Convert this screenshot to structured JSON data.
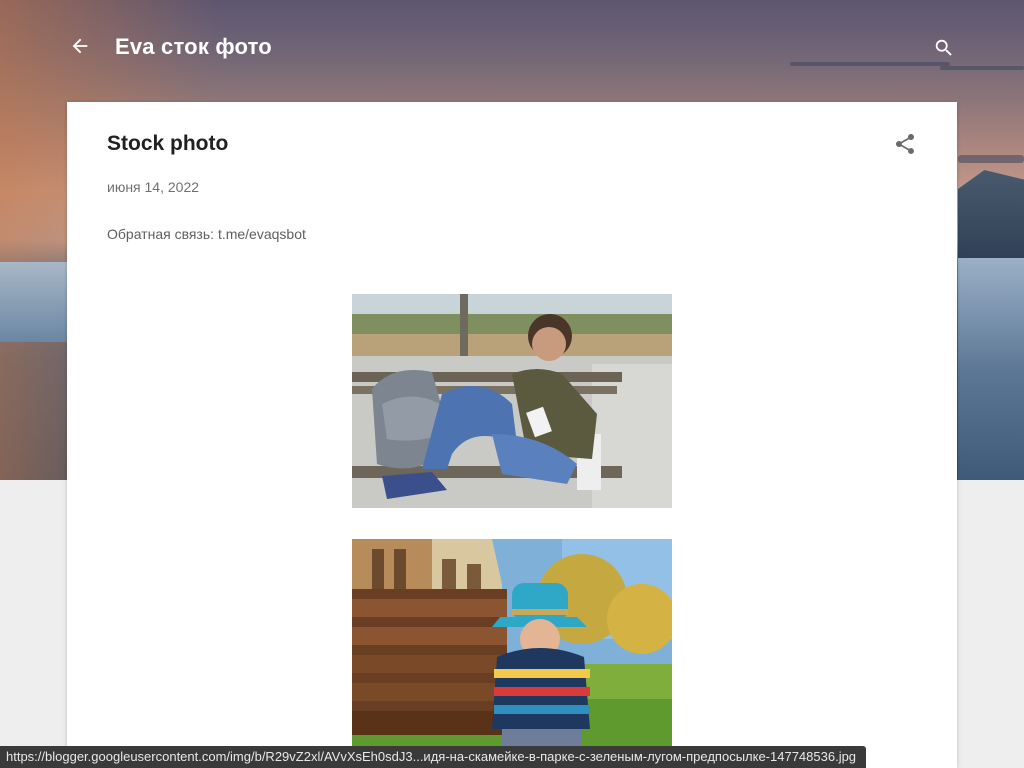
{
  "header": {
    "blog_title": "Eva сток фото",
    "back_icon": "arrow-back-icon",
    "search_icon": "search-icon"
  },
  "post": {
    "title": "Stock photo",
    "date": "июня 14, 2022",
    "feedback_label": "Обратная связь: ",
    "feedback_link": "t.me/evaqsbot",
    "share_icon": "share-icon",
    "images": [
      {
        "alt": "boy-with-backpack-on-bench-photo"
      },
      {
        "alt": "boy-in-hat-on-bench-in-park-photo"
      }
    ]
  },
  "statusbar": {
    "url": "https://blogger.googleusercontent.com/img/b/R29vZ2xl/AVvXsEh0sdJ3...идя-на-скамейке-в-парке-с-зеленым-лугом-предпосылке-147748536.jpg"
  },
  "colors": {
    "header_text": "#ffffff",
    "card_bg": "#ffffff",
    "page_bg": "#eeeeee"
  }
}
